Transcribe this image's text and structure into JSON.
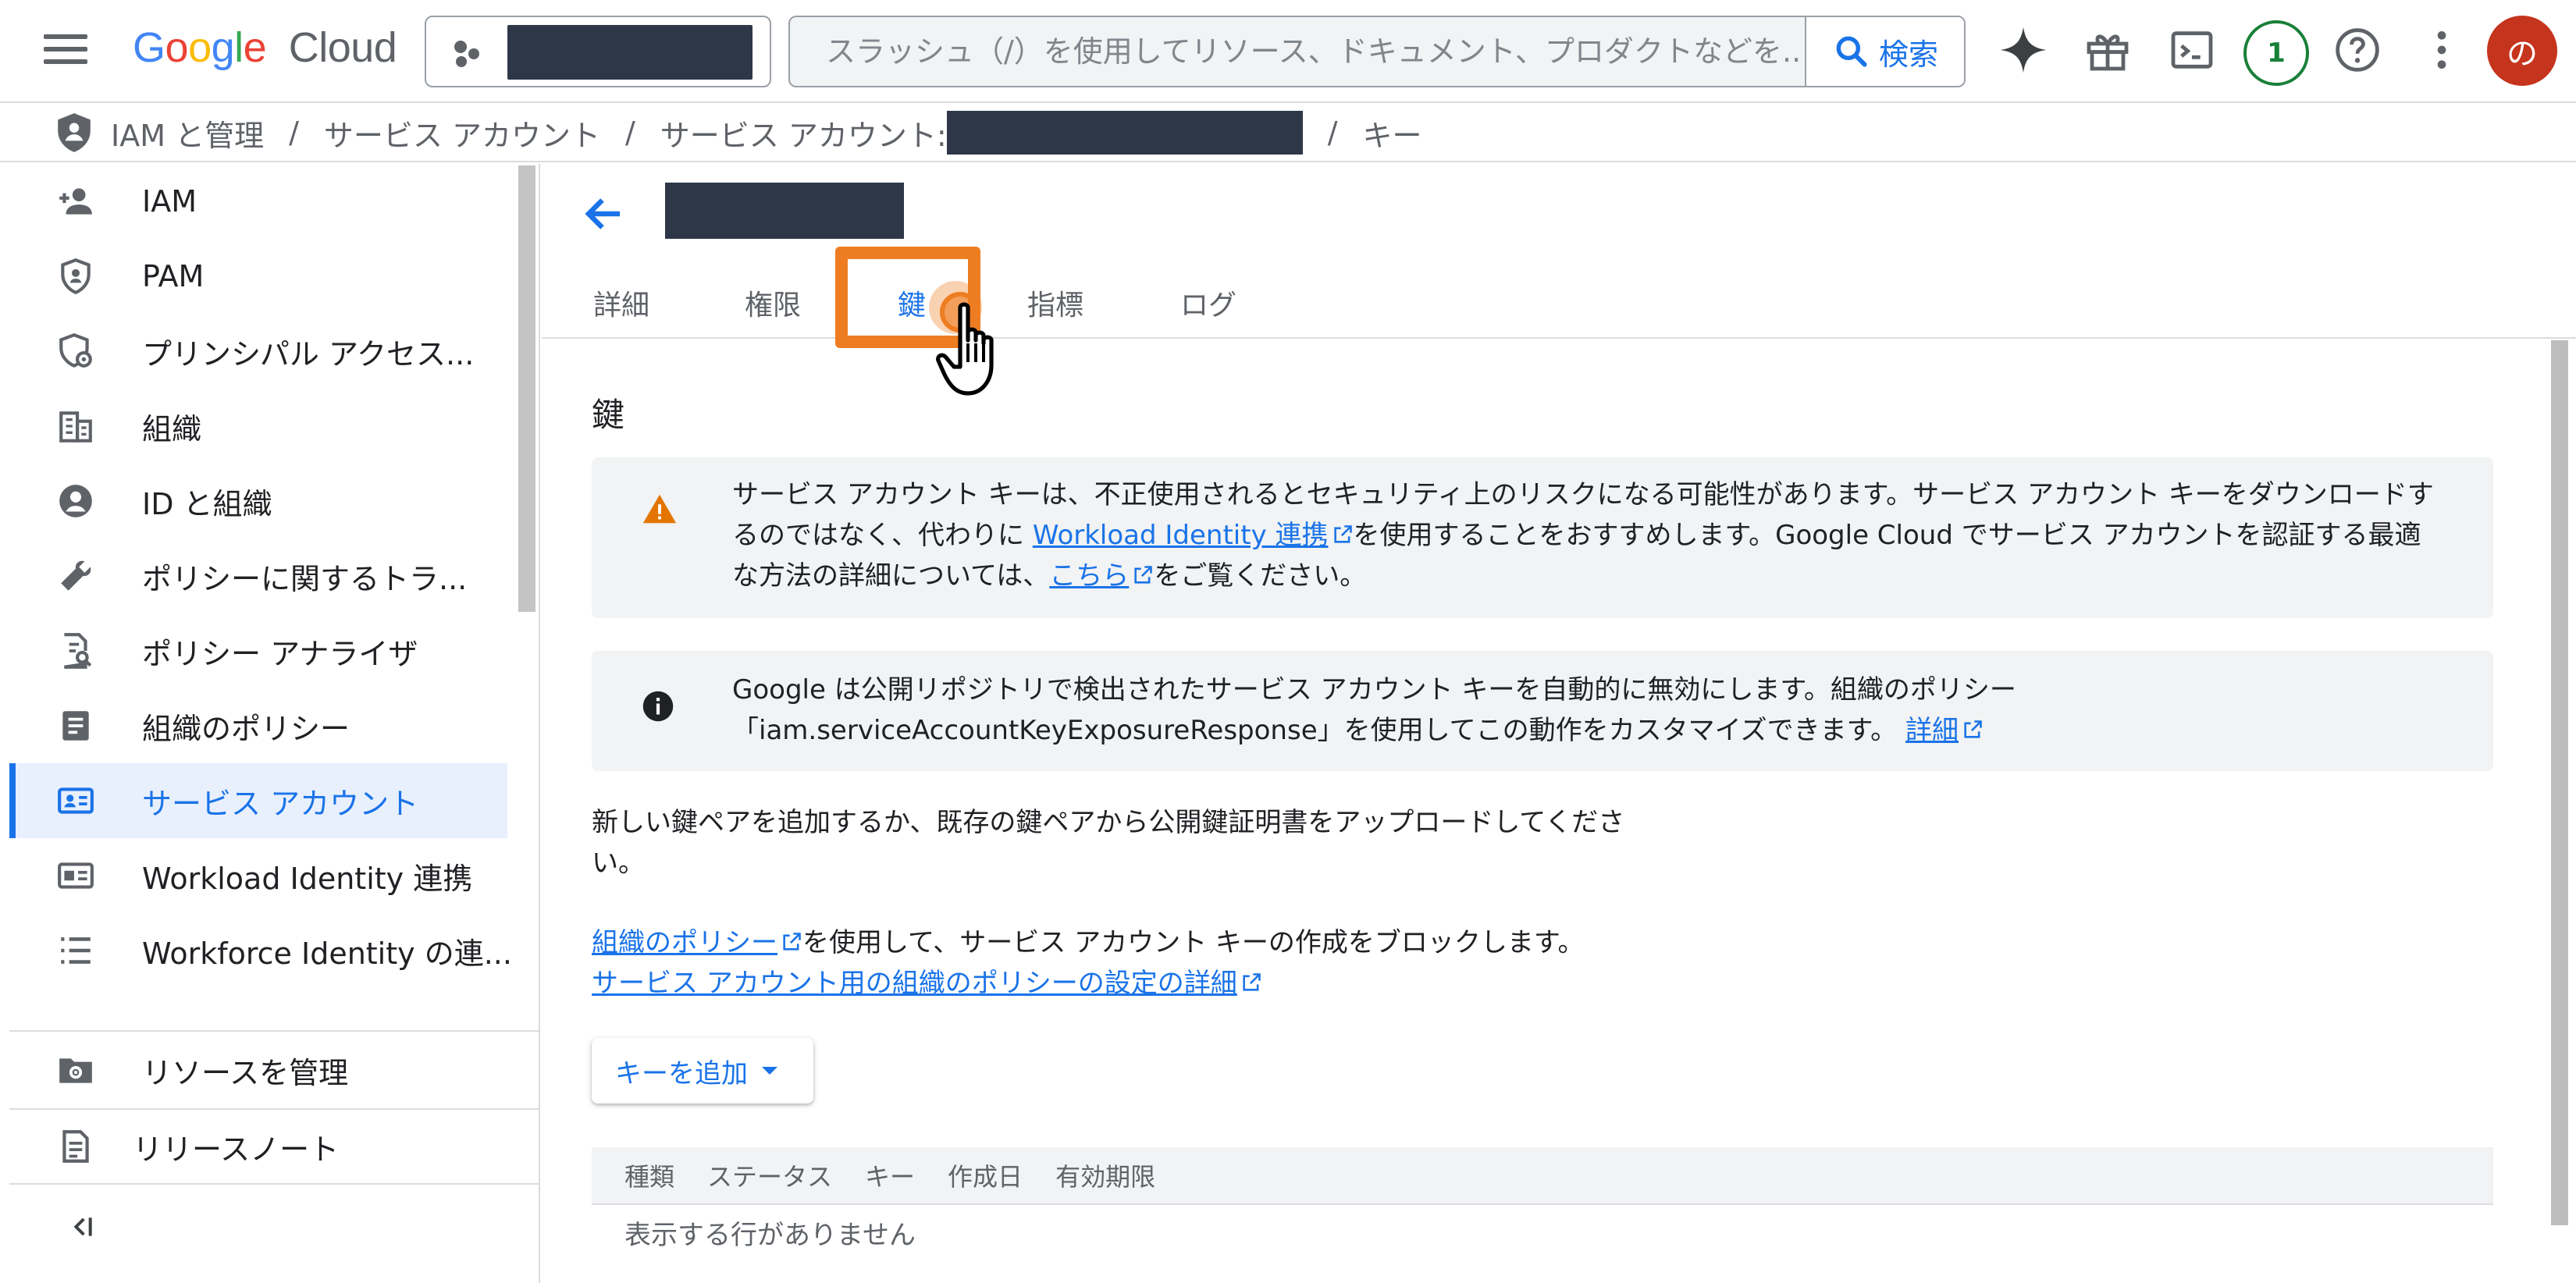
{
  "header": {
    "logo_google": "Google",
    "logo_cloud": "Cloud",
    "search_placeholder": "スラッシュ（/）を使用してリソース、ドキュメント、プロダクトなどを...",
    "search_button": "検索",
    "notification_count": "1",
    "avatar_initial": "の"
  },
  "breadcrumb": {
    "items": [
      "IAM と管理",
      "サービス アカウント",
      "サービス アカウント:",
      "キー"
    ],
    "separator": "/"
  },
  "sidebar": {
    "items": [
      {
        "label": "IAM",
        "icon": "person-add-icon"
      },
      {
        "label": "PAM",
        "icon": "shield-icon"
      },
      {
        "label": "プリンシパル アクセス...",
        "icon": "shield-gear-icon"
      },
      {
        "label": "組織",
        "icon": "building-icon"
      },
      {
        "label": "ID と組織",
        "icon": "account-circle-icon"
      },
      {
        "label": "ポリシーに関するトラ...",
        "icon": "wrench-icon"
      },
      {
        "label": "ポリシー アナライザ",
        "icon": "document-search-icon"
      },
      {
        "label": "組織のポリシー",
        "icon": "document-icon"
      },
      {
        "label": "サービス アカウント",
        "icon": "service-account-icon",
        "active": true
      },
      {
        "label": "Workload Identity 連携",
        "icon": "id-card-icon"
      },
      {
        "label": "Workforce Identity の連...",
        "icon": "list-icon"
      }
    ],
    "bottom": [
      {
        "label": "リソースを管理",
        "icon": "folder-gear-icon"
      },
      {
        "label": "リリースノート",
        "icon": "release-notes-icon"
      }
    ],
    "collapse_icon": "collapse-icon"
  },
  "tabs": [
    "詳細",
    "権限",
    "鍵",
    "指標",
    "ログ"
  ],
  "active_tab": "鍵",
  "section": {
    "title": "鍵",
    "warning": {
      "before": "サービス アカウント キーは、不正使用されるとセキュリティ上のリスクになる可能性があります。サービス アカウント キーをダウンロードするのではなく、代わりに ",
      "link1": "Workload Identity 連携",
      "middle": "を使用することをおすすめします。Google Cloud でサービス アカウントを認証する最適な方法の詳細については、",
      "link2": "こちら",
      "after": "をご覧ください。"
    },
    "info": {
      "text": "Google は公開リポジトリで検出されたサービス アカウント キーを自動的に無効にします。組織のポリシー「iam.serviceAccountKeyExposureResponse」を使用してこの動作をカスタマイズできます。",
      "link": "詳細"
    },
    "intro": "新しい鍵ペアを追加するか、既存の鍵ペアから公開鍵証明書をアップロードしてください。",
    "policy_link": "組織のポリシー",
    "policy_text": "を使用して、サービス アカウント キーの作成をブロックします。",
    "policy_details_link": "サービス アカウント用の組織のポリシーの設定の詳細",
    "add_key_button": "キーを追加"
  },
  "table": {
    "columns": [
      "種類",
      "ステータス",
      "キー",
      "作成日",
      "有効期限"
    ],
    "empty_message": "表示する行がありません"
  },
  "colors": {
    "accent": "#1a73e8",
    "highlight": "#ee7d22",
    "warning": "#e37400",
    "avatar": "#c5341c",
    "badge": "#188038"
  }
}
